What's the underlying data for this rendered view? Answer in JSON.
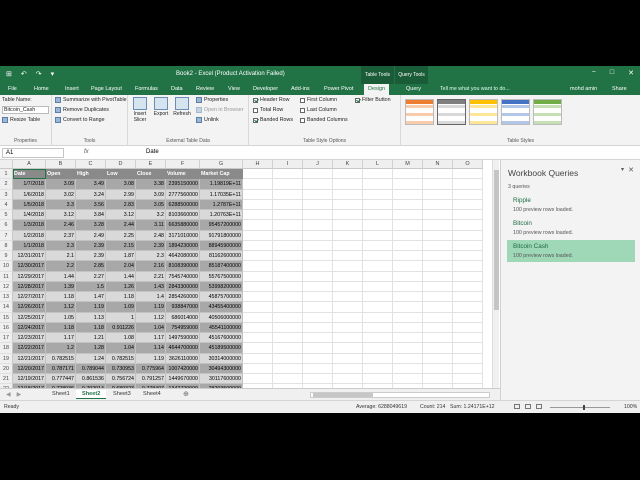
{
  "titlebar": {
    "title": "Book2 - Excel (Product Activation Failed)",
    "table_tools": "Table Tools",
    "query_tools": "Query Tools",
    "qat": [
      "⊞",
      "↶",
      "↷",
      "▾"
    ],
    "controls": [
      "−",
      "□",
      "✕"
    ],
    "user": "mohd amin",
    "share": "Share",
    "tell_me": "Tell me what you want to do..."
  },
  "tabs": [
    "File",
    "Home",
    "Insert",
    "Page Layout",
    "Formulas",
    "Data",
    "Review",
    "View",
    "Developer",
    "Add-ins",
    "Power Pivot",
    "Design",
    "Query"
  ],
  "active_tab": "Design",
  "ribbon": {
    "properties": {
      "table_name_label": "Table Name:",
      "table_name_value": "Bitcoin_Cash",
      "resize": "Resize Table",
      "group": "Properties"
    },
    "tools": {
      "items": [
        "Summarize with PivotTable",
        "Remove Duplicates",
        "Convert to Range"
      ],
      "group": "Tools"
    },
    "external": {
      "insert_slicer": "Insert Slicer",
      "export": "Export",
      "refresh": "Refresh",
      "items": [
        "Properties",
        "Open in Browser",
        "Unlink"
      ],
      "group": "External Table Data"
    },
    "style_options": {
      "col1": [
        {
          "label": "Header Row",
          "checked": true
        },
        {
          "label": "Total Row",
          "checked": false
        },
        {
          "label": "Banded Rows",
          "checked": true
        }
      ],
      "col2": [
        {
          "label": "First Column",
          "checked": false
        },
        {
          "label": "Last Column",
          "checked": false
        },
        {
          "label": "Banded Columns",
          "checked": false
        }
      ],
      "col3": [
        {
          "label": "Filter Button",
          "checked": true
        }
      ],
      "group": "Table Style Options"
    },
    "styles": {
      "group": "Table Styles",
      "swatches": [
        {
          "header": "#ed7d31",
          "band": "#f8cbad",
          "selected": false
        },
        {
          "header": "#7f7f7f",
          "band": "#d9d9d9",
          "selected": true
        },
        {
          "header": "#ffc000",
          "band": "#ffe699",
          "selected": false
        },
        {
          "header": "#4472c4",
          "band": "#b4c6e7",
          "selected": false
        },
        {
          "header": "#70ad47",
          "band": "#c6e0b4",
          "selected": false
        }
      ]
    }
  },
  "formula_bar": {
    "name_box": "A1",
    "fx": "fx",
    "value": "Date"
  },
  "grid": {
    "columns": [
      "A",
      "B",
      "C",
      "D",
      "E",
      "F",
      "G",
      "H",
      "I",
      "J",
      "K",
      "L",
      "M",
      "N",
      "O"
    ],
    "headers": [
      "Date",
      "Open",
      "High",
      "Low",
      "Close",
      "Volume",
      "Market Cap"
    ],
    "rows": [
      [
        "1/7/2018",
        "3.09",
        "3.49",
        "3.08",
        "3.38",
        "2395150000",
        "1.19819E+11"
      ],
      [
        "1/6/2018",
        "3.02",
        "3.24",
        "2.99",
        "3.09",
        "2777560000",
        "1.17035E+11"
      ],
      [
        "1/5/2018",
        "3.3",
        "3.56",
        "2.83",
        "3.05",
        "6288500000",
        "1.2787E+11"
      ],
      [
        "1/4/2018",
        "3.12",
        "3.84",
        "3.12",
        "3.2",
        "8103660000",
        "1.20763E+11"
      ],
      [
        "1/3/2018",
        "2.46",
        "3.28",
        "2.44",
        "3.11",
        "6635880000",
        "95457200000"
      ],
      [
        "1/2/2018",
        "2.37",
        "2.49",
        "2.25",
        "2.48",
        "3171010000",
        "91791800000"
      ],
      [
        "1/1/2018",
        "2.3",
        "2.39",
        "2.15",
        "2.39",
        "1894230000",
        "88945900000"
      ],
      [
        "12/31/2017",
        "2.1",
        "2.39",
        "1.87",
        "2.3",
        "4642080000",
        "81162600000"
      ],
      [
        "12/30/2017",
        "2.2",
        "2.85",
        "2.04",
        "2.16",
        "8108390000",
        "85187400000"
      ],
      [
        "12/29/2017",
        "1.44",
        "2.27",
        "1.44",
        "2.21",
        "7545740000",
        "55767500000"
      ],
      [
        "12/28/2017",
        "1.39",
        "1.5",
        "1.26",
        "1.43",
        "2843300000",
        "53998200000"
      ],
      [
        "12/27/2017",
        "1.18",
        "1.47",
        "1.18",
        "1.4",
        "2854260000",
        "45875700000"
      ],
      [
        "12/26/2017",
        "1.12",
        "1.19",
        "1.09",
        "1.19",
        "938847000",
        "43455400000"
      ],
      [
        "12/25/2017",
        "1.05",
        "1.13",
        "1",
        "1.12",
        "686014000",
        "40506000000"
      ],
      [
        "12/24/2017",
        "1.18",
        "1.18",
        "0.911226",
        "1.04",
        "754959000",
        "45541100000"
      ],
      [
        "12/23/2017",
        "1.17",
        "1.21",
        "1.08",
        "1.17",
        "1497590000",
        "45167600000"
      ],
      [
        "12/22/2017",
        "1.2",
        "1.28",
        "1.04",
        "1.14",
        "4644700000",
        "45189500000"
      ],
      [
        "12/21/2017",
        "0.782515",
        "1.24",
        "0.782515",
        "1.19",
        "3626110000",
        "30314000000"
      ],
      [
        "12/20/2017",
        "0.787171",
        "0.789044",
        "0.730953",
        "0.775964",
        "1007420000",
        "30494300000"
      ],
      [
        "12/19/2017",
        "0.777447",
        "0.861536",
        "0.756724",
        "0.791257",
        "1449670000",
        "30117600000"
      ],
      [
        "12/18/2017",
        "0.728036",
        "0.792014",
        "0.689323",
        "0.778407",
        "1342720000",
        "28203500000"
      ],
      [
        "12/17/2017",
        "0.754125",
        "0.765981",
        "0.719929",
        "0.728366",
        "805200000",
        "29214200000"
      ],
      [
        "12/16/2017",
        "0.75",
        "0.754181",
        "0.704457",
        "0.754267",
        "818888000",
        "29263500000"
      ]
    ]
  },
  "pane": {
    "title": "Workbook Queries",
    "count": "3 queries",
    "queries": [
      {
        "name": "Ripple",
        "status": "100 preview rows loaded.",
        "selected": false
      },
      {
        "name": "Bitcoin",
        "status": "100 preview rows loaded.",
        "selected": false
      },
      {
        "name": "Bitcoin Cash",
        "status": "100 preview rows loaded.",
        "selected": true
      }
    ]
  },
  "sheets": [
    "Sheet1",
    "Sheet2",
    "Sheet3",
    "Sheet4"
  ],
  "active_sheet": "Sheet2",
  "status": {
    "ready": "Ready",
    "average": "Average: 6288049619",
    "count": "Count: 214",
    "sum": "Sum: 1.24171E+12",
    "zoom": "100%"
  }
}
